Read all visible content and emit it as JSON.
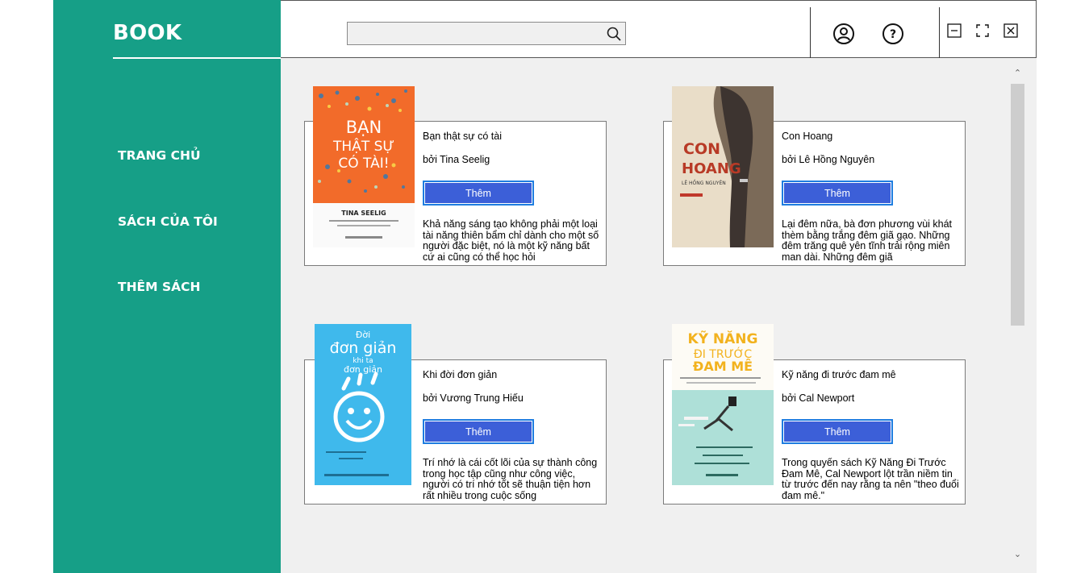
{
  "app": {
    "brand": "BOOK"
  },
  "sidebar": {
    "items": [
      {
        "label": "TRANG CHỦ"
      },
      {
        "label": "SÁCH CỦA TÔI"
      },
      {
        "label": "THÊM SÁCH"
      }
    ]
  },
  "search": {
    "value": "",
    "placeholder": ""
  },
  "topbar_icons": [
    "user-icon",
    "help-icon",
    "minimize-icon",
    "maximize-icon",
    "close-icon"
  ],
  "books": [
    {
      "title": "Bạn thật sự có tài",
      "author": "bởi Tina Seelig",
      "button": "Thêm",
      "description": "Khả năng sáng tạo không phải một loại tài năng thiên bẩm chỉ dành cho một số người đặc biệt, nó là một kỹ năng bất cứ ai cũng có thể học hỏi",
      "cover": {
        "line1": "BẠN",
        "line2": "THẬT SỰ",
        "line3": "CÓ TÀI!",
        "author": "TINA SEELIG",
        "bg": "#f26b2a"
      }
    },
    {
      "title": "Con Hoang",
      "author": "bởi Lê Hồng Nguyên",
      "button": "Thêm",
      "description": "Lại đêm nữa, bà đơn phương vùi khát thèm bằng trắng đêm giã gạo. Những đêm trăng quê yên tĩnh trải rộng miên man dài. Những đêm giã",
      "cover": {
        "line1": "CON",
        "line2": "HOANG",
        "author": "LÊ HỒNG NGUYÊN",
        "bg": "#e9ddc8"
      }
    },
    {
      "title": "Khi đời đơn giản",
      "author": "bởi Vương Trung Hiếu",
      "button": "Thêm",
      "description": "Trí nhớ là cái cốt lõi của sự thành công trong học tập cũng như công việc, người có trí nhớ tốt sẽ thuận tiện hơn rất nhiều trong cuộc sống",
      "cover": {
        "line1": "Đời",
        "line2": "đơn giản",
        "line3": "khi ta",
        "line4": "đơn giản",
        "bg": "#3fb9ec"
      }
    },
    {
      "title": "Kỹ năng đi trước đam mê",
      "author": "bởi Cal Newport",
      "button": "Thêm",
      "description": "Trong quyển sách Kỹ Năng Đi Trước Đam Mê, Cal Newport lột trần niềm tin từ trước đến nay rằng ta nên \"theo đuổi đam mê.\"",
      "cover": {
        "line1": "KỸ NĂNG",
        "line2": "ĐI TRƯỚC",
        "line3": "ĐAM MÊ",
        "bg": "#aee0d8"
      }
    }
  ],
  "colors": {
    "sidebar": "#169f87",
    "button": "#3c5fd8",
    "button_border": "#1e7de0"
  }
}
